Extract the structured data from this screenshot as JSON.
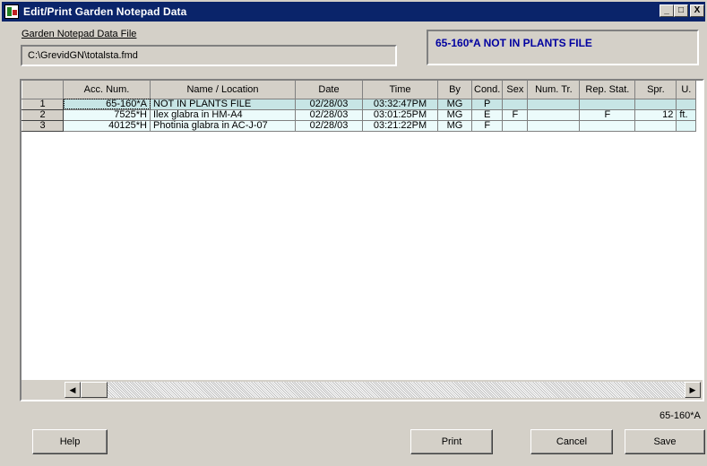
{
  "window": {
    "title": "Edit/Print Garden Notepad Data",
    "buttons": {
      "minimize": "_",
      "maximize": "□",
      "close": "X"
    }
  },
  "file": {
    "label": "Garden Notepad Data File",
    "path": "C:\\GrevidGN\\totalsta.fmd"
  },
  "current_plant": "65-160*A NOT IN PLANTS FILE",
  "table": {
    "columns": [
      "",
      "Acc. Num.",
      "Name / Location",
      "Date",
      "Time",
      "By",
      "Cond.",
      "Sex",
      "Num. Tr.",
      "Rep. Stat.",
      "Spr.",
      "U."
    ],
    "rows": [
      {
        "num": "1",
        "acc": "65-160*A",
        "name": "NOT IN PLANTS FILE",
        "date": "02/28/03",
        "time": "03:32:47PM",
        "by": "MG",
        "cond": "P",
        "sex": "",
        "numtr": "",
        "repstat": "",
        "spr": "",
        "u": ""
      },
      {
        "num": "2",
        "acc": "7525*H",
        "name": "Ilex glabra in HM-A4",
        "date": "02/28/03",
        "time": "03:01:25PM",
        "by": "MG",
        "cond": "E",
        "sex": "F",
        "numtr": "",
        "repstat": "F",
        "spr": "12",
        "u": "ft."
      },
      {
        "num": "3",
        "acc": "40125*H",
        "name": "Photinia glabra in AC-J-07",
        "date": "02/28/03",
        "time": "03:21:22PM",
        "by": "MG",
        "cond": "F",
        "sex": "",
        "numtr": "",
        "repstat": "",
        "spr": "",
        "u": ""
      }
    ]
  },
  "scrollbar": {
    "left_icon": "left-arrow-icon",
    "right_icon": "right-arrow-icon",
    "left_glyph": "◀",
    "right_glyph": "▶"
  },
  "status_text": "65-160*A",
  "buttons": {
    "help": "Help",
    "print": "Print",
    "cancel": "Cancel",
    "save": "Save"
  }
}
